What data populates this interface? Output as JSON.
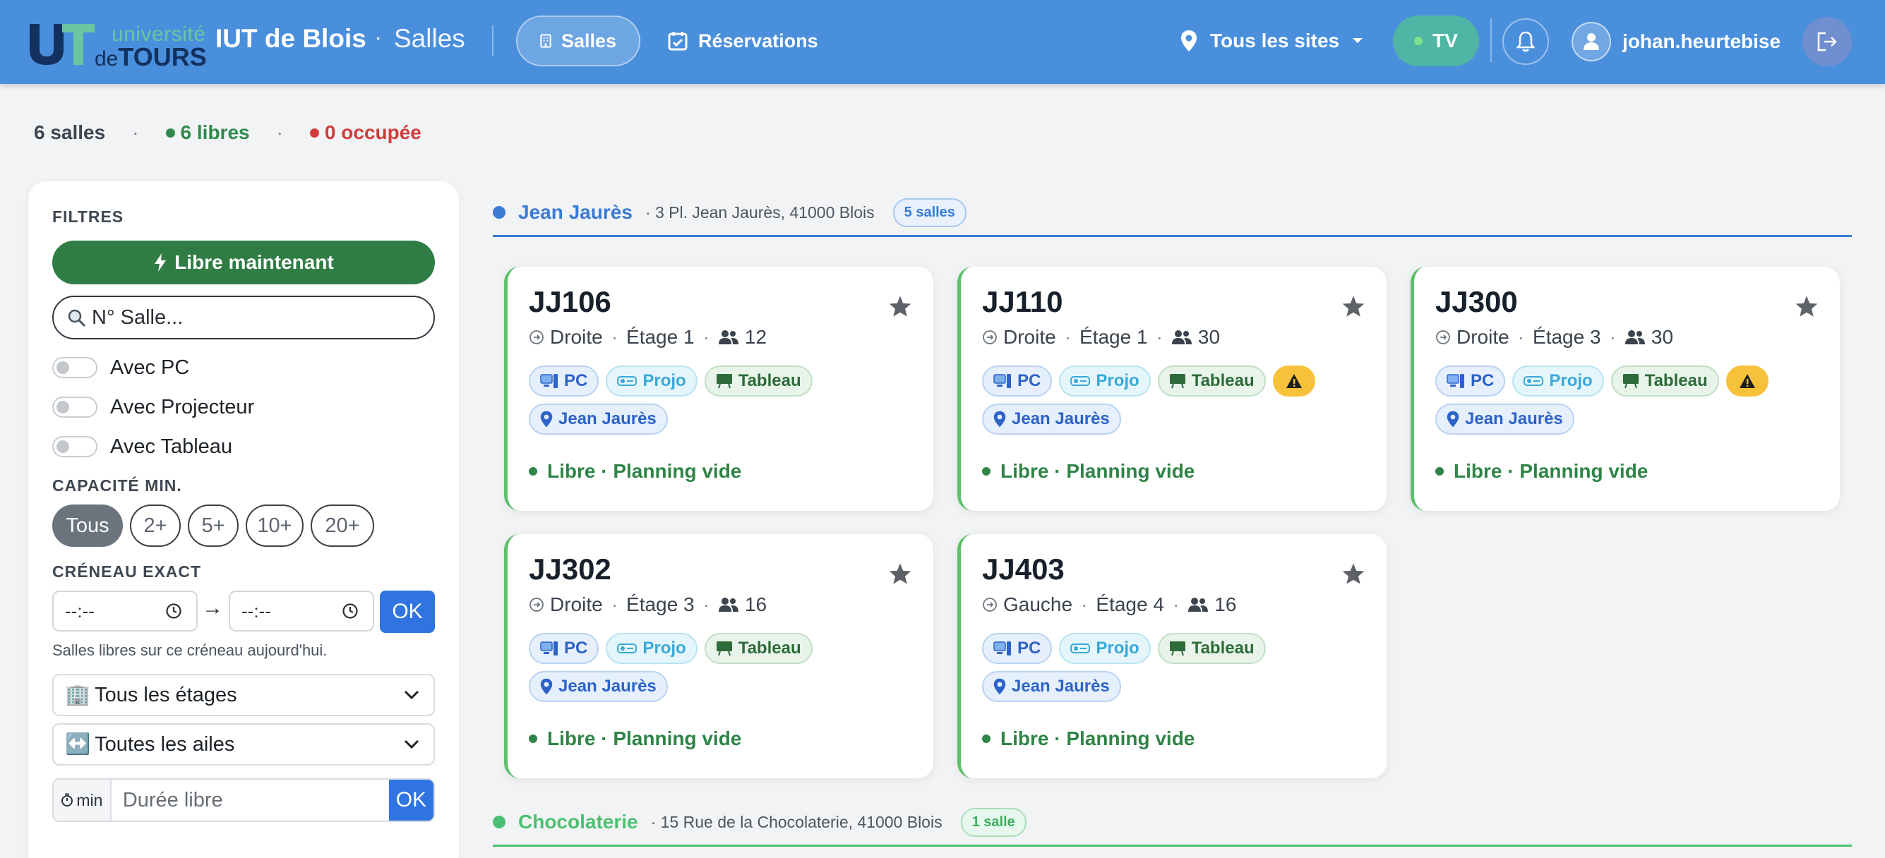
{
  "header": {
    "logo_line1": "université",
    "logo_de": "de",
    "logo_line2": "TOURS",
    "brand": "IUT de Blois",
    "separator": "·",
    "section": "Salles",
    "nav": [
      {
        "label": "Salles",
        "icon": "building-icon",
        "active": true
      },
      {
        "label": "Réservations",
        "icon": "calendar-check-icon",
        "active": false
      }
    ],
    "site_select": "Tous les sites",
    "tv_label": "TV",
    "username": "johan.heurtebise",
    "colors": {
      "bar": "#4a8fdc",
      "tv": "#4fb5a5"
    }
  },
  "summary": {
    "count": "6 salles",
    "sep": "·",
    "free": "6 libres",
    "busy": "0 occupée",
    "free_color": "#2f8a4b",
    "busy_color": "#d33c3c"
  },
  "filters": {
    "heading": "FILTRES",
    "free_now": "Libre maintenant",
    "search_placeholder": "N° Salle...",
    "toggles": [
      "Avec PC",
      "Avec Projecteur",
      "Avec Tableau"
    ],
    "capacity_heading": "CAPACITÉ MIN.",
    "capacity_options": [
      "Tous",
      "2+",
      "5+",
      "10+",
      "20+"
    ],
    "capacity_selected": "Tous",
    "slot_heading": "CRÉNEAU EXACT",
    "time_from": "--:--",
    "time_to": "--:--",
    "arrow": "→",
    "ok": "OK",
    "slot_hint": "Salles libres sur ce créneau aujourd'hui.",
    "floors_select": "Tous les étages",
    "wings_select": "Toutes les ailes",
    "duration_unit": "min",
    "duration_placeholder": "Durée libre",
    "duration_ok": "OK"
  },
  "sites": [
    {
      "name": "Jean Jaurès",
      "address": "· 3 Pl. Jean Jaurès, 41000 Blois",
      "badge": "5 salles",
      "color": "#3a7bd5"
    },
    {
      "name": "Chocolaterie",
      "address": "· 15 Rue de la Chocolaterie, 41000 Blois",
      "badge": "1 salle",
      "color": "#4cc072"
    }
  ],
  "rooms": [
    {
      "name": "JJ106",
      "wing": "Droite",
      "floor": "Étage 1",
      "capacity": "12",
      "chips": [
        "PC",
        "Projo",
        "Tableau"
      ],
      "warning": false,
      "site": "Jean Jaurès",
      "status": "Libre · Planning vide"
    },
    {
      "name": "JJ110",
      "wing": "Droite",
      "floor": "Étage 1",
      "capacity": "30",
      "chips": [
        "PC",
        "Projo",
        "Tableau"
      ],
      "warning": true,
      "site": "Jean Jaurès",
      "status": "Libre · Planning vide"
    },
    {
      "name": "JJ300",
      "wing": "Droite",
      "floor": "Étage 3",
      "capacity": "30",
      "chips": [
        "PC",
        "Projo",
        "Tableau"
      ],
      "warning": true,
      "site": "Jean Jaurès",
      "status": "Libre · Planning vide"
    },
    {
      "name": "JJ302",
      "wing": "Droite",
      "floor": "Étage 3",
      "capacity": "16",
      "chips": [
        "PC",
        "Projo",
        "Tableau"
      ],
      "warning": false,
      "site": "Jean Jaurès",
      "status": "Libre · Planning vide"
    },
    {
      "name": "JJ403",
      "wing": "Gauche",
      "floor": "Étage 4",
      "capacity": "16",
      "chips": [
        "PC",
        "Projo",
        "Tableau"
      ],
      "warning": false,
      "site": "Jean Jaurès",
      "status": "Libre · Planning vide"
    }
  ],
  "room_meta_sep": "·"
}
